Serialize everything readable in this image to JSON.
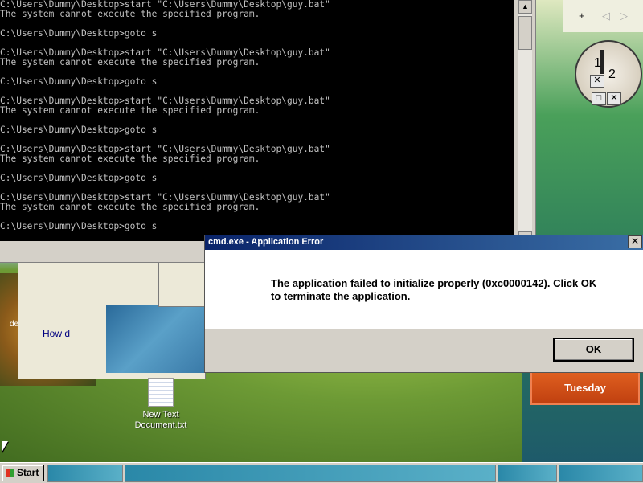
{
  "console": {
    "lines": [
      "C:\\Users\\Dummy\\Desktop>start \"C:\\Users\\Dummy\\Desktop\\guy.bat\"",
      "The system cannot execute the specified program.",
      "",
      "C:\\Users\\Dummy\\Desktop>goto s",
      "",
      "C:\\Users\\Dummy\\Desktop>start \"C:\\Users\\Dummy\\Desktop\\guy.bat\"",
      "The system cannot execute the specified program.",
      "",
      "C:\\Users\\Dummy\\Desktop>goto s",
      "",
      "C:\\Users\\Dummy\\Desktop>start \"C:\\Users\\Dummy\\Desktop\\guy.bat\"",
      "The system cannot execute the specified program.",
      "",
      "C:\\Users\\Dummy\\Desktop>goto s",
      "",
      "C:\\Users\\Dummy\\Desktop>start \"C:\\Users\\Dummy\\Desktop\\guy.bat\"",
      "The system cannot execute the specified program.",
      "",
      "C:\\Users\\Dummy\\Desktop>goto s",
      "",
      "C:\\Users\\Dummy\\Desktop>start \"C:\\Users\\Dummy\\Desktop\\guy.bat\"",
      "The system cannot execute the specified program.",
      "",
      "C:\\Users\\Dummy\\Desktop>goto s"
    ]
  },
  "dialog": {
    "title": "cmd.exe - Application Error",
    "message": "The application failed to initialize properly (0xc0000142). Click OK to terminate the application.",
    "ok_label": "OK",
    "close_glyph": "✕"
  },
  "background": {
    "link_text": "How d",
    "partial_text": "de"
  },
  "sidebar": {
    "add_glyph": "+",
    "prev_glyph": "◁",
    "next_glyph": "▷",
    "clock_numbers": [
      "1",
      "2"
    ],
    "calendar_day": "Tuesday"
  },
  "desktop": {
    "icon_label_line1": "New Text",
    "icon_label_line2": "Document.txt"
  },
  "taskbar": {
    "start_label": "Start"
  },
  "icons": {
    "close": "close-icon",
    "scroll_up": "arrow-up-icon",
    "scroll_down": "arrow-down-icon",
    "start": "windows-logo-icon",
    "file": "text-file-icon"
  }
}
